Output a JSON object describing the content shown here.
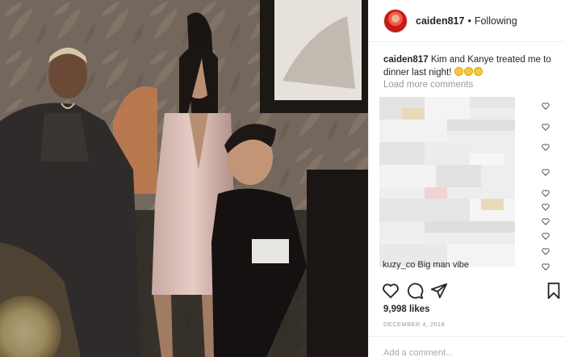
{
  "post": {
    "username": "caiden817",
    "separator": "•",
    "follow_status": "Following"
  },
  "caption": {
    "username": "caiden817",
    "text": "Kim and Kanye treated me to dinner last night!",
    "emoji_count": 3
  },
  "comments": {
    "load_more": "Load more comments",
    "last_visible": "kuzy_co Big man vibe"
  },
  "stats": {
    "likes": "9,998 likes",
    "date": "DECEMBER 4, 2018"
  },
  "add_comment": {
    "placeholder": "Add a comment..."
  },
  "icons": {
    "like": "heart-icon",
    "comment": "comment-icon",
    "share": "share-icon",
    "save": "bookmark-icon"
  }
}
